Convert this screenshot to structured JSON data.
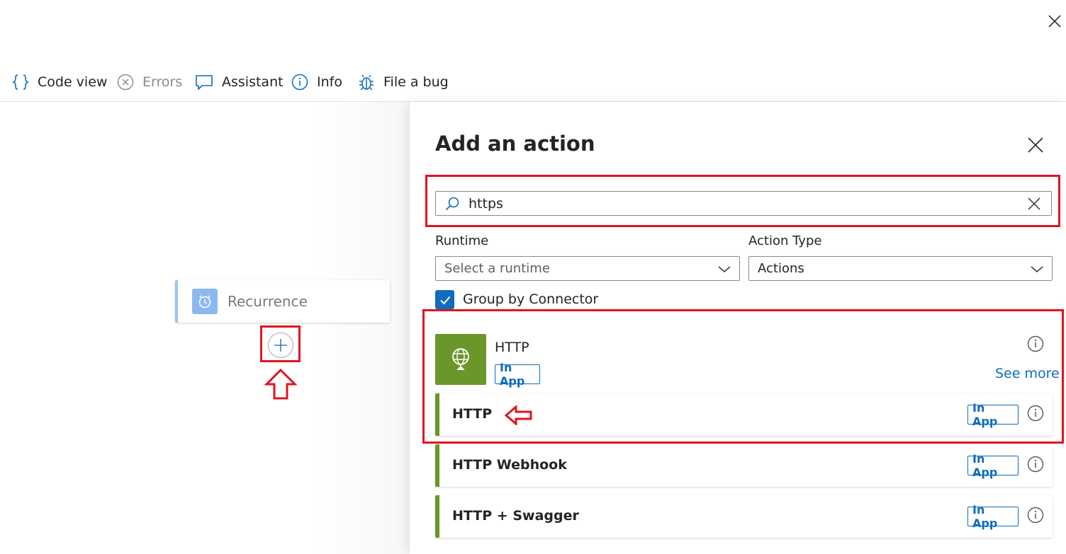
{
  "window": {
    "close_icon": "close-icon"
  },
  "toolbar": {
    "items": [
      {
        "label": "Code view",
        "icon": "code-braces-icon",
        "disabled": false
      },
      {
        "label": "Errors",
        "icon": "error-circle-icon",
        "disabled": true
      },
      {
        "label": "Assistant",
        "icon": "chat-icon",
        "disabled": false
      },
      {
        "label": "Info",
        "icon": "info-icon",
        "disabled": false
      },
      {
        "label": "File a bug",
        "icon": "bug-icon",
        "disabled": false
      }
    ]
  },
  "canvas": {
    "trigger": {
      "label": "Recurrence",
      "icon": "clock-icon"
    },
    "add_button_icon": "plus-icon"
  },
  "panel": {
    "title": "Add an action",
    "search": {
      "value": "https",
      "placeholder": "Search"
    },
    "runtime": {
      "label": "Runtime",
      "placeholder": "Select a runtime"
    },
    "action_type": {
      "label": "Action Type",
      "value": "Actions"
    },
    "group_by_connector": {
      "label": "Group by Connector",
      "checked": true
    },
    "connector": {
      "name": "HTTP",
      "badge": "In App",
      "see_more": "See more",
      "icon": "globe-icon"
    },
    "operations": [
      {
        "label": "HTTP",
        "badge": "In App"
      },
      {
        "label": "HTTP Webhook",
        "badge": "In App"
      },
      {
        "label": "HTTP + Swagger",
        "badge": "In App"
      }
    ]
  },
  "colors": {
    "accent": "#0f6cbd",
    "connector_green": "#6a962a",
    "highlight_red": "#e0141e"
  }
}
